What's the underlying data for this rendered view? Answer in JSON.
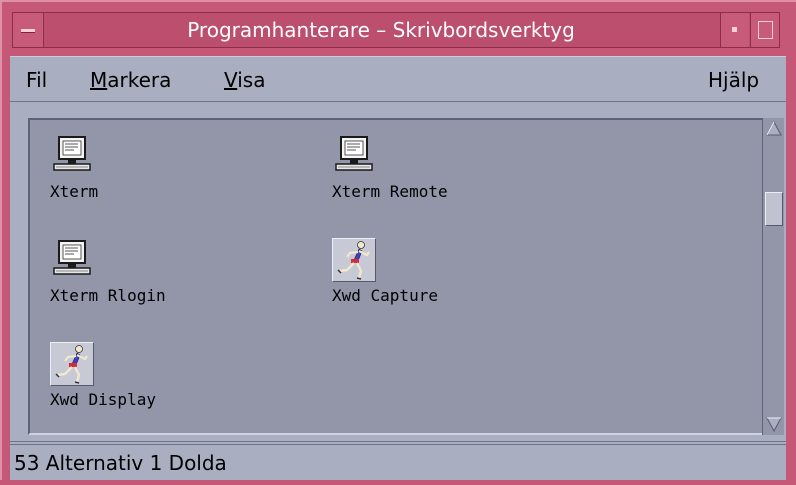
{
  "window": {
    "title": "Programhanterare – Skrivbordsverktyg"
  },
  "menubar": {
    "items": [
      {
        "label_pre": "",
        "label_mn": "F",
        "label_post": "il"
      },
      {
        "label_pre": "",
        "label_mn": "M",
        "label_post": "arkera"
      },
      {
        "label_pre": "",
        "label_mn": "V",
        "label_post": "isa"
      },
      {
        "label_pre": "",
        "label_mn": "H",
        "label_post": "jälp"
      }
    ]
  },
  "apps": [
    {
      "label": "Xterm",
      "icon": "terminal-icon"
    },
    {
      "label": "Xterm Remote",
      "icon": "terminal-icon"
    },
    {
      "label": "Xterm Rlogin",
      "icon": "terminal-icon"
    },
    {
      "label": "Xwd Capture",
      "icon": "runner-icon"
    },
    {
      "label": "Xwd Display",
      "icon": "runner-icon"
    }
  ],
  "status": {
    "text": "53 Alternativ 1 Dolda"
  },
  "colors": {
    "titlebar": "#c45876",
    "panel": "#a9aec0",
    "iconview": "#9296a8"
  }
}
